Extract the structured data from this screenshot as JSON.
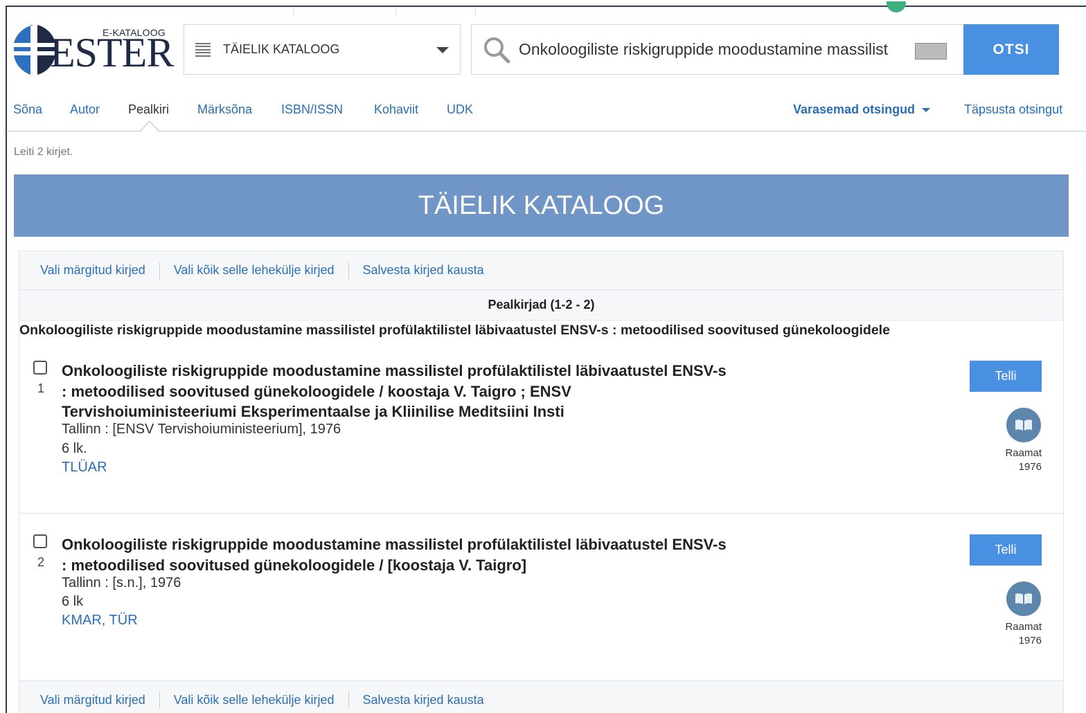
{
  "header": {
    "logo_small": "E-KATALOOG",
    "logo_big": "ESTER",
    "catalog_select": "TÄIELIK KATALOOG",
    "search_value": "Onkoloogiliste riskigruppide moodustamine massilist",
    "search_button": "OTSI"
  },
  "tabs": {
    "items": [
      "Sõna",
      "Autor",
      "Pealkiri",
      "Märksõna",
      "ISBN/ISSN",
      "Kohaviit",
      "UDK"
    ],
    "active": "Pealkiri",
    "previous_searches": "Varasemad otsingud",
    "refine": "Täpsusta otsingut"
  },
  "results": {
    "found_text": "Leiti 2 kirjet.",
    "banner": "TÄIELIK KATALOOG",
    "actions": [
      "Vali märgitud kirjed",
      "Vali kõik selle lehekülje kirjed",
      "Salvesta kirjed kausta"
    ],
    "column_header": "Pealkirjad (1-2 - 2)",
    "group_title": "Onkoloogiliste riskigruppide moodustamine massilistel profülaktilistel läbivaatustel ENSV-s : metoodilised soovitused günekoloogidele"
  },
  "records": [
    {
      "number": "1",
      "title": "Onkoloogiliste riskigruppide moodustamine massilistel profülaktilistel läbivaatustel ENSV-s : metoodilised soovitused günekoloogidele / koostaja V. Taigro ; ENSV Tervishoiuministeeriumi Eksperimentaalse ja Kliinilise Meditsiini Insti",
      "publication": "Tallinn : [ENSV Tervishoiuministeerium], 1976",
      "extent": "6 lk.",
      "location": "TLÜAR",
      "order_button": "Telli",
      "type": "Raamat",
      "year": "1976"
    },
    {
      "number": "2",
      "title": "Onkoloogiliste riskigruppide moodustamine massilistel profülaktilistel läbivaatustel ENSV-s : metoodilised soovitused günekoloogidele / [koostaja V. Taigro]",
      "publication": "Tallinn : [s.n.], 1976",
      "extent": "6 lk",
      "location": "KMAR, TÜR",
      "order_button": "Telli",
      "type": "Raamat",
      "year": "1976"
    }
  ],
  "colors": {
    "accent": "#4a90e2",
    "banner": "#6f96c6",
    "link": "#2a6fb5",
    "logo": "#1f2a44"
  },
  "icons": [
    "globe-logo-icon",
    "list-icon",
    "chevron-down-icon",
    "search-icon",
    "keyboard-icon",
    "book-icon"
  ]
}
